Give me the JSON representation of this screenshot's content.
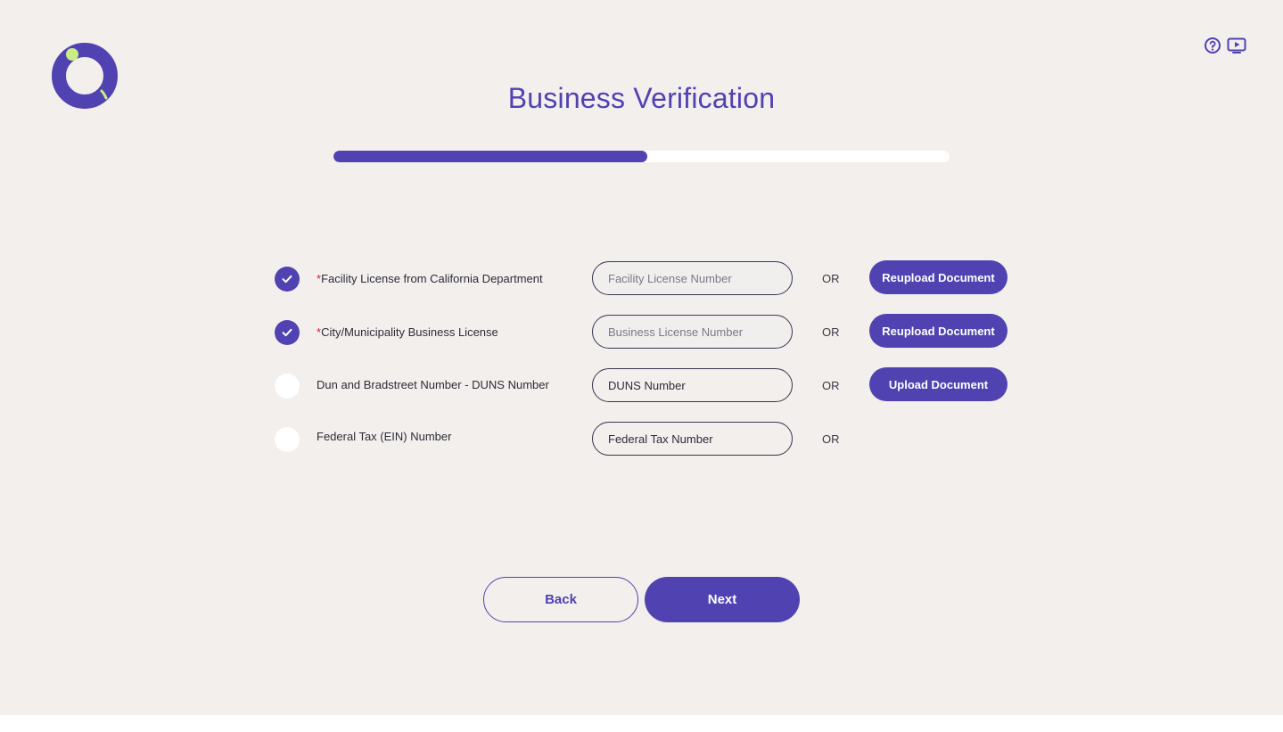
{
  "header": {
    "logo_icon": "app-logo-ring",
    "help_icon": "help-circle-icon",
    "video_icon": "video-tutorial-icon",
    "title": "Business Verification"
  },
  "progress": {
    "fraction": 0.51
  },
  "colors": {
    "accent": "#5142b2",
    "required": "#d0202f",
    "logo_dot": "#c9ec84",
    "background": "#f3efec"
  },
  "rows": [
    {
      "checked": true,
      "required": true,
      "required_mark": "*",
      "label": "Facility License from California Department",
      "input_placeholder": "Facility License Number",
      "or_label": "OR",
      "upload_label": "Reupload Document"
    },
    {
      "checked": true,
      "required": true,
      "required_mark": "*",
      "label": "City/Municipality Business License",
      "input_placeholder": "Business License Number",
      "or_label": "OR",
      "upload_label": "Reupload Document"
    },
    {
      "checked": false,
      "required": false,
      "label": "Dun and Bradstreet Number - DUNS Number",
      "input_placeholder": "DUNS Number",
      "or_label": "OR",
      "upload_label": "Upload Document"
    },
    {
      "checked": false,
      "required": false,
      "label": "Federal Tax (EIN) Number",
      "input_placeholder": "Federal Tax Number",
      "or_label": "OR"
    }
  ],
  "footer": {
    "back_label": "Back",
    "next_label": "Next"
  }
}
